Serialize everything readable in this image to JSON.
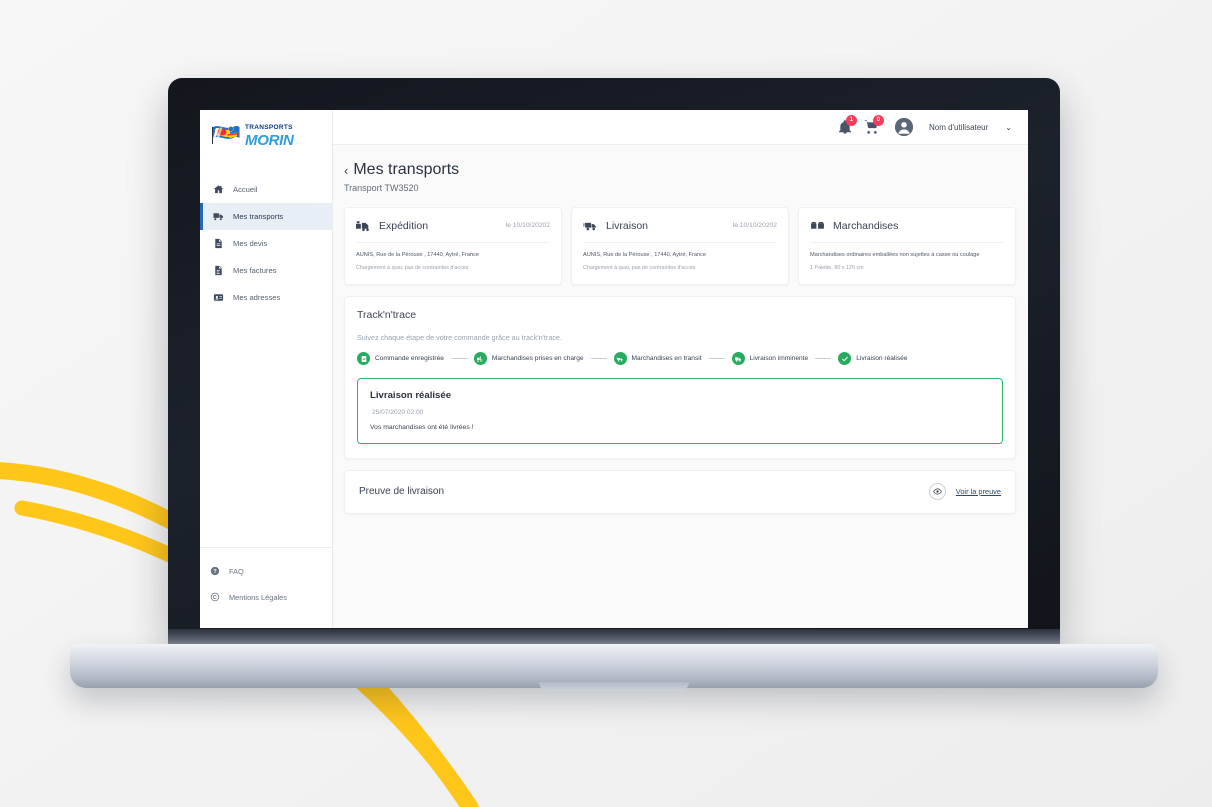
{
  "topbar": {
    "notifications_icon": "bell-icon",
    "notifications_badge": "1",
    "cart_icon": "cart-icon",
    "cart_badge": "0",
    "avatar_icon": "user-avatar-icon",
    "username": "Nom d'utilisateur",
    "chevron": "⌄"
  },
  "sidebar": {
    "logo": {
      "line1": "TRANSPORTS",
      "line2": "MORIN",
      "flag_icon": "flag-icon",
      "colors": {
        "blue": "#1f6fd0",
        "yellow": "#ffd200",
        "red": "#e63329",
        "text_blue": "#0b3a8c",
        "brand_blue": "#2e9ddd"
      }
    },
    "items": [
      {
        "label": "Accueil",
        "icon": "home-icon",
        "active": false
      },
      {
        "label": "Mes transports",
        "icon": "truck-icon",
        "active": true
      },
      {
        "label": "Mes devis",
        "icon": "document-icon",
        "active": false
      },
      {
        "label": "Mes factures",
        "icon": "invoice-icon",
        "active": false
      },
      {
        "label": "Mes adresses",
        "icon": "address-book-icon",
        "active": false
      }
    ],
    "footer": [
      {
        "label": "FAQ",
        "icon": "question-circle-icon"
      },
      {
        "label": "Mentions Légales",
        "icon": "copyright-icon"
      }
    ]
  },
  "page": {
    "back_chevron": "‹",
    "title": "Mes transports",
    "subtitle": "Transport TW3520"
  },
  "cards": [
    {
      "icon": "shipment-truck-icon",
      "title": "Expédition",
      "date": "le 10/10/20202",
      "address": "AUNIS, Rue de la Pérouse , 17440, Aytré, France",
      "note": "Chargement à quai, pas de contraintes d'accès"
    },
    {
      "icon": "delivery-truck-icon",
      "title": "Livraison",
      "date": "le 10/10/20202",
      "address": "AUNIS, Rue de la Pérouse , 17440, Aytré, France",
      "note": "Chargement à quai, pas de contraintes d'accès"
    },
    {
      "icon": "boxes-icon",
      "title": "Marchandises",
      "date": "",
      "address": "Marchandises ordinaires emballées non sujettes à casse ou coulage",
      "note": "1 Palette, 80 x 120 cm"
    }
  ],
  "track": {
    "title": "Track'n'trace",
    "subtitle": "Suivez chaque étape de votre commande grâce au track'n'trace.",
    "step_color": "#27ab5f",
    "steps": [
      {
        "label": "Commande enregistrée",
        "icon": "clipboard-check-icon",
        "done": true
      },
      {
        "label": "Marchandises prises en charge",
        "icon": "forklift-icon",
        "done": true
      },
      {
        "label": "Marchandises en transit",
        "icon": "transit-truck-icon",
        "done": true
      },
      {
        "label": "Livraison imminente",
        "icon": "van-icon",
        "done": true
      },
      {
        "label": "Livraison réalisée",
        "icon": "check-icon",
        "done": true
      }
    ],
    "status": {
      "title": "Livraison réalisée",
      "timestamp": "25/07/2020 02:00",
      "message": "Vos marchandises ont été livrées !",
      "border_color": "#35b26a"
    }
  },
  "proof": {
    "title": "Preuve de livraison",
    "eye_icon": "eye-icon",
    "link": "Voir la preuve"
  },
  "decor": {
    "background_color": "#f4f4f4",
    "accent_yellow": "#ffc61a"
  }
}
